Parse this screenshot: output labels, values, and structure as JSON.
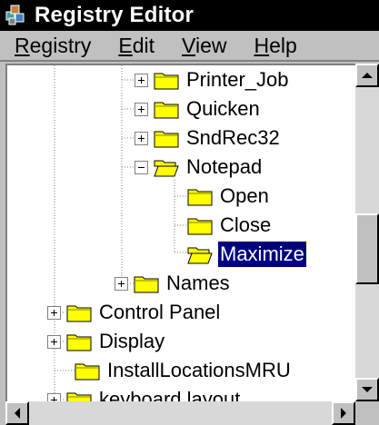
{
  "window": {
    "title": "Registry Editor",
    "icon": "registry-icon"
  },
  "menu": [
    {
      "label": "Registry",
      "mnemonic": "R"
    },
    {
      "label": "Edit",
      "mnemonic": "E"
    },
    {
      "label": "View",
      "mnemonic": "V"
    },
    {
      "label": "Help",
      "mnemonic": "H"
    }
  ],
  "tree": {
    "nodes": [
      {
        "label": "Printer_Job",
        "expander": "plus",
        "icon": "folder-closed-icon"
      },
      {
        "label": "Quicken",
        "expander": "plus",
        "icon": "folder-closed-icon"
      },
      {
        "label": "SndRec32",
        "expander": "plus",
        "icon": "folder-closed-icon"
      },
      {
        "label": "Notepad",
        "expander": "minus",
        "icon": "folder-open-icon"
      },
      {
        "label": "Open",
        "expander": "none",
        "icon": "folder-closed-icon"
      },
      {
        "label": "Close",
        "expander": "none",
        "icon": "folder-closed-icon"
      },
      {
        "label": "Maximize",
        "expander": "none",
        "icon": "folder-open-icon",
        "selected": true
      },
      {
        "label": "Names",
        "expander": "plus",
        "icon": "folder-closed-icon"
      },
      {
        "label": "Control Panel",
        "expander": "plus",
        "icon": "folder-closed-icon"
      },
      {
        "label": "Display",
        "expander": "plus",
        "icon": "folder-closed-icon"
      },
      {
        "label": "InstallLocationsMRU",
        "expander": "none",
        "icon": "folder-closed-icon"
      },
      {
        "label": "keyboard layout",
        "expander": "plus",
        "icon": "folder-closed-icon"
      }
    ]
  },
  "colors": {
    "titlebar_bg": "#000000",
    "selection_bg": "#000080",
    "folder_yellow": "#ffff00",
    "window_gray": "#c0c0c0"
  }
}
